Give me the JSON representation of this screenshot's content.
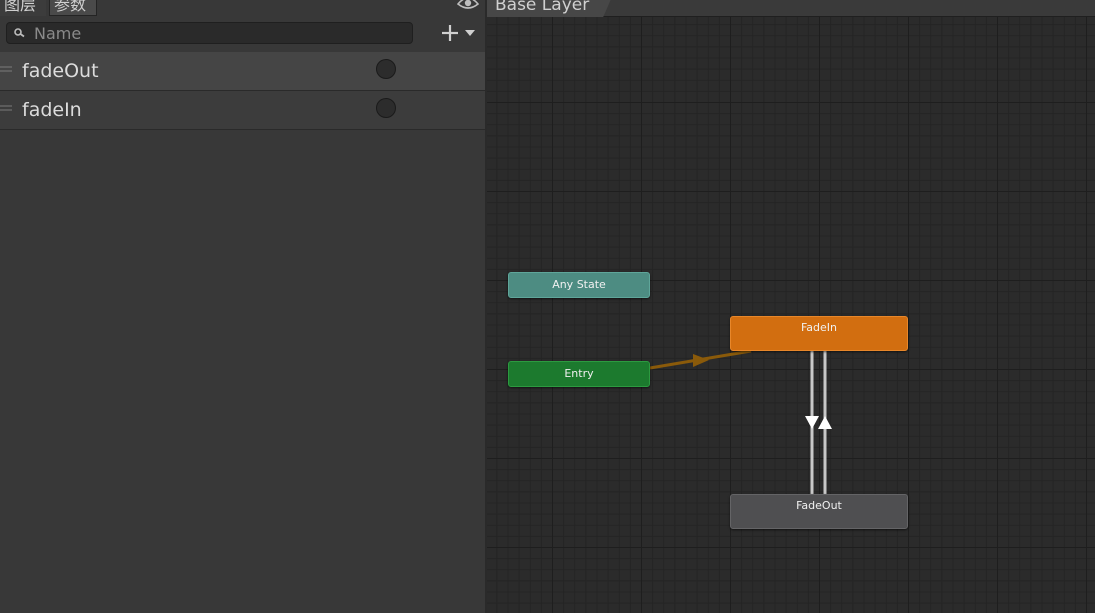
{
  "tabs": {
    "layers_label": "图层",
    "parameters_label": "参数"
  },
  "search": {
    "placeholder": "Name"
  },
  "parameters": [
    {
      "name": "fadeOut",
      "type": "trigger",
      "selected": true
    },
    {
      "name": "fadeIn",
      "type": "trigger",
      "selected": false
    }
  ],
  "graph": {
    "breadcrumb": "Base Layer",
    "nodes": {
      "any_state": "Any State",
      "entry": "Entry",
      "fadein": "FadeIn",
      "fadeout": "FadeOut"
    }
  },
  "colors": {
    "any_state": "#4d8c82",
    "entry": "#1c7a2e",
    "default_state": "#d26e10",
    "state": "#4f4f51",
    "entry_transition": "#8a5a0a",
    "transition": "#cfcfcf"
  },
  "icons": [
    "eye-icon",
    "search-icon",
    "add-icon",
    "dropdown-arrow-icon",
    "drag-handle-icon"
  ]
}
